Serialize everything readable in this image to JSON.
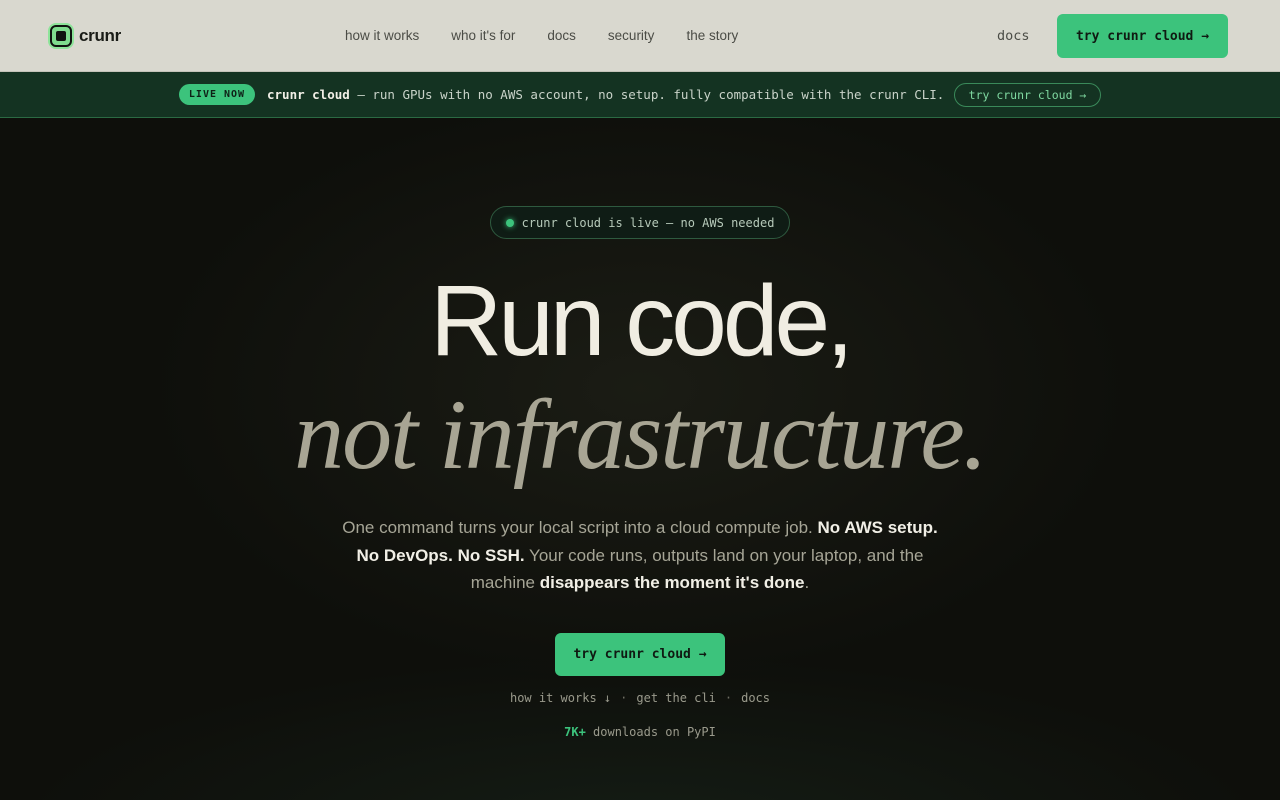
{
  "brand": {
    "name": "crunr",
    "logo_icon": "square-chip-icon",
    "accent": "#3cc37c"
  },
  "nav": {
    "links": [
      "how it works",
      "who it's for",
      "docs",
      "security",
      "the story"
    ],
    "docs": "docs",
    "cta": "try crunr cloud →"
  },
  "banner": {
    "badge": "LIVE NOW",
    "product": "crunr cloud",
    "text": " — run GPUs with no AWS account, no setup. fully compatible with the crunr CLI.",
    "button": "try crunr cloud →"
  },
  "hero": {
    "status": "crunr cloud is live — no AWS needed",
    "headline_1": "Run code,",
    "headline_2": "not infrastructure.",
    "sub_1": "One command turns your local script into a cloud compute job. ",
    "sub_2": "No AWS setup. No DevOps. No SSH.",
    "sub_3": " Your code runs, outputs land on your laptop, and the machine ",
    "sub_4": "disappears the moment it's done",
    "sub_5": ".",
    "cta": "try crunr cloud →",
    "links": [
      "how it works ↓",
      "get the cli",
      "docs"
    ],
    "link_separator": "·",
    "downloads_count": "7K+",
    "downloads_text": " downloads on PyPI"
  }
}
